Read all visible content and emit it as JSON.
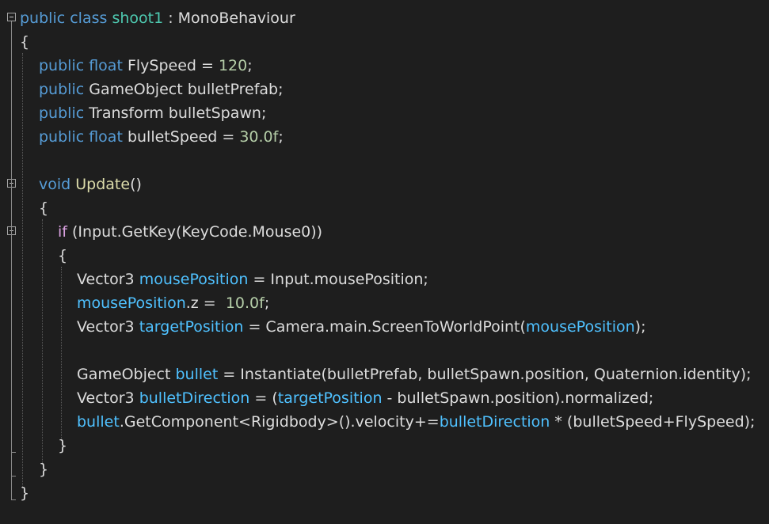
{
  "code": {
    "lines": [
      [
        {
          "t": "kw",
          "v": "public"
        },
        {
          "t": "plain",
          "v": " "
        },
        {
          "t": "kw",
          "v": "class"
        },
        {
          "t": "plain",
          "v": " "
        },
        {
          "t": "type",
          "v": "shoot1"
        },
        {
          "t": "plain",
          "v": " : "
        },
        {
          "t": "id",
          "v": "MonoBehaviour"
        }
      ],
      [
        {
          "t": "plain",
          "v": "{"
        }
      ],
      [
        {
          "t": "kw",
          "v": "public"
        },
        {
          "t": "plain",
          "v": " "
        },
        {
          "t": "kw",
          "v": "float"
        },
        {
          "t": "plain",
          "v": " "
        },
        {
          "t": "id",
          "v": "FlySpeed"
        },
        {
          "t": "plain",
          "v": " = "
        },
        {
          "t": "num",
          "v": "120"
        },
        {
          "t": "plain",
          "v": ";"
        }
      ],
      [
        {
          "t": "kw",
          "v": "public"
        },
        {
          "t": "plain",
          "v": " "
        },
        {
          "t": "id",
          "v": "GameObject"
        },
        {
          "t": "plain",
          "v": " "
        },
        {
          "t": "id",
          "v": "bulletPrefab"
        },
        {
          "t": "plain",
          "v": ";"
        }
      ],
      [
        {
          "t": "kw",
          "v": "public"
        },
        {
          "t": "plain",
          "v": " "
        },
        {
          "t": "id",
          "v": "Transform"
        },
        {
          "t": "plain",
          "v": " "
        },
        {
          "t": "id",
          "v": "bulletSpawn"
        },
        {
          "t": "plain",
          "v": ";"
        }
      ],
      [
        {
          "t": "kw",
          "v": "public"
        },
        {
          "t": "plain",
          "v": " "
        },
        {
          "t": "kw",
          "v": "float"
        },
        {
          "t": "plain",
          "v": " "
        },
        {
          "t": "id",
          "v": "bulletSpeed"
        },
        {
          "t": "plain",
          "v": " = "
        },
        {
          "t": "num",
          "v": "30.0f"
        },
        {
          "t": "plain",
          "v": ";"
        }
      ],
      [],
      [
        {
          "t": "kw",
          "v": "void"
        },
        {
          "t": "plain",
          "v": " "
        },
        {
          "t": "fn",
          "v": "Update"
        },
        {
          "t": "plain",
          "v": "()"
        }
      ],
      [
        {
          "t": "plain",
          "v": "{"
        }
      ],
      [
        {
          "t": "kw2",
          "v": "if"
        },
        {
          "t": "plain",
          "v": " (Input.GetKey(KeyCode.Mouse0))"
        }
      ],
      [
        {
          "t": "plain",
          "v": "{"
        }
      ],
      [
        {
          "t": "id",
          "v": "Vector3"
        },
        {
          "t": "plain",
          "v": " "
        },
        {
          "t": "field",
          "v": "mousePosition"
        },
        {
          "t": "plain",
          "v": " = Input.mousePosition;"
        }
      ],
      [
        {
          "t": "field",
          "v": "mousePosition"
        },
        {
          "t": "plain",
          "v": ".z =  "
        },
        {
          "t": "num",
          "v": "10.0f"
        },
        {
          "t": "plain",
          "v": ";"
        }
      ],
      [
        {
          "t": "id",
          "v": "Vector3"
        },
        {
          "t": "plain",
          "v": " "
        },
        {
          "t": "field",
          "v": "targetPosition"
        },
        {
          "t": "plain",
          "v": " = Camera.main.ScreenToWorldPoint("
        },
        {
          "t": "field",
          "v": "mousePosition"
        },
        {
          "t": "plain",
          "v": ");"
        }
      ],
      [],
      [
        {
          "t": "id",
          "v": "GameObject"
        },
        {
          "t": "plain",
          "v": " "
        },
        {
          "t": "field",
          "v": "bullet"
        },
        {
          "t": "plain",
          "v": " = Instantiate(bulletPrefab, bulletSpawn.position, Quaternion.identity);"
        }
      ],
      [
        {
          "t": "id",
          "v": "Vector3"
        },
        {
          "t": "plain",
          "v": " "
        },
        {
          "t": "field",
          "v": "bulletDirection"
        },
        {
          "t": "plain",
          "v": " = ("
        },
        {
          "t": "field",
          "v": "targetPosition"
        },
        {
          "t": "plain",
          "v": " - bulletSpawn.position).normalized;"
        }
      ],
      [
        {
          "t": "field",
          "v": "bullet"
        },
        {
          "t": "plain",
          "v": ".GetComponent<Rigidbody>().velocity+="
        },
        {
          "t": "field",
          "v": "bulletDirection"
        },
        {
          "t": "plain",
          "v": " * (bulletSpeed+FlySpeed);"
        }
      ],
      [
        {
          "t": "plain",
          "v": "}"
        }
      ],
      [
        {
          "t": "plain",
          "v": "}"
        }
      ],
      [
        {
          "t": "plain",
          "v": "}"
        }
      ]
    ]
  },
  "colors": {
    "background": "#1e1e1e",
    "keyword": "#569cd6",
    "control_keyword": "#d8a0df",
    "type": "#4ec9b0",
    "number": "#b5cea8",
    "method": "#dcdcaa",
    "local_variable": "#4fc1ff",
    "text": "#dcdcdc"
  },
  "fold_markers": [
    "class-fold-icon",
    "update-method-fold-icon",
    "if-block-fold-icon"
  ]
}
